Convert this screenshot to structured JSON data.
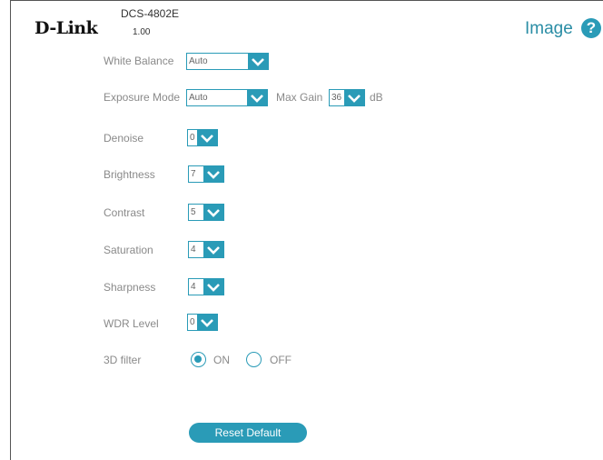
{
  "header": {
    "logo": "D-Link",
    "model": "DCS-4802E",
    "firmware": "1.00",
    "page_title": "Image",
    "help_icon_glyph": "?"
  },
  "settings": {
    "white_balance": {
      "label": "White Balance",
      "value": "Auto"
    },
    "exposure_mode": {
      "label": "Exposure Mode",
      "value": "Auto"
    },
    "max_gain": {
      "label": "Max Gain",
      "value": "36",
      "unit": "dB"
    },
    "denoise": {
      "label": "Denoise",
      "value": "0"
    },
    "brightness": {
      "label": "Brightness",
      "value": "7"
    },
    "contrast": {
      "label": "Contrast",
      "value": "5"
    },
    "saturation": {
      "label": "Saturation",
      "value": "4"
    },
    "sharpness": {
      "label": "Sharpness",
      "value": "4"
    },
    "wdr_level": {
      "label": "WDR Level",
      "value": "0"
    },
    "filter_3d": {
      "label": "3D filter",
      "on_label": "ON",
      "off_label": "OFF",
      "selected": "ON"
    }
  },
  "buttons": {
    "reset_default": "Reset Default"
  },
  "colors": {
    "accent": "#2a9bb7",
    "title": "#2a8da5",
    "label": "#8a8a8a"
  }
}
